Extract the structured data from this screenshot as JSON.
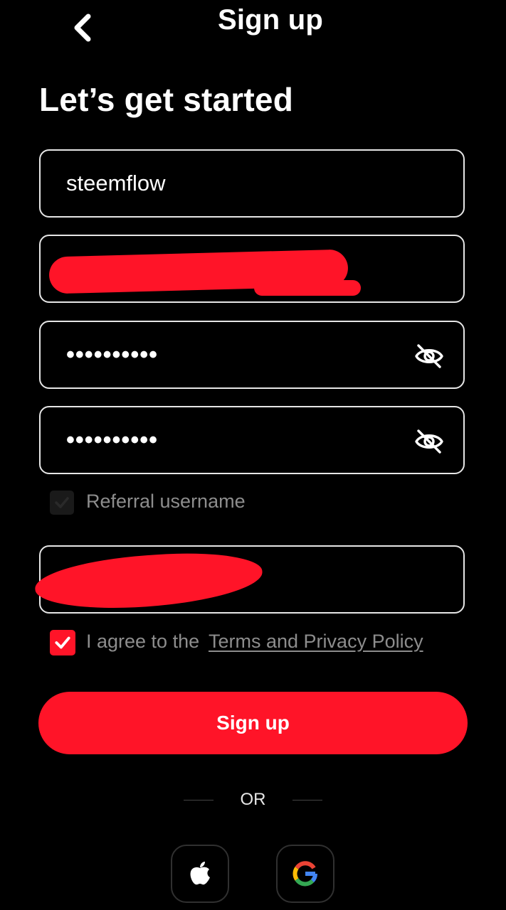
{
  "header": {
    "title": "Sign up",
    "back_icon": "chevron-left-icon"
  },
  "headline": "Let’s get started",
  "form": {
    "username": {
      "value": "steemflow"
    },
    "email": {
      "value": "",
      "redacted": true
    },
    "password": {
      "mask": "••••••••••",
      "toggle_icon": "eye-off-icon"
    },
    "confirm_password": {
      "mask": "••••••••••",
      "toggle_icon": "eye-off-icon"
    },
    "referral": {
      "checkbox_label": "Referral username",
      "checked": true,
      "value": "",
      "redacted": true
    }
  },
  "agreement": {
    "prefix": "I agree to the",
    "link": "Terms and Privacy Policy",
    "checked": true
  },
  "signup_button": "Sign up",
  "separator": "OR",
  "social": [
    {
      "name": "apple",
      "icon": "apple-icon"
    },
    {
      "name": "google",
      "icon": "google-icon"
    }
  ],
  "colors": {
    "accent": "#ff1428",
    "background": "#000000",
    "text": "#ffffff",
    "muted": "#8d8d8d",
    "border": "#e6e6e6"
  }
}
